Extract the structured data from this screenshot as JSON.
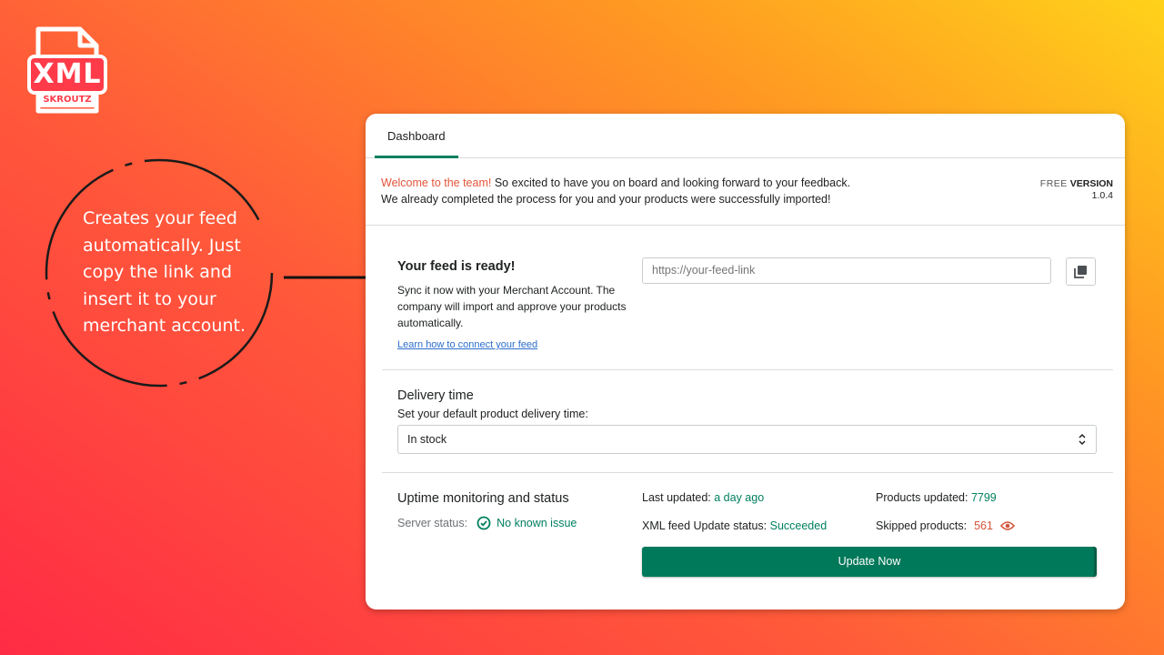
{
  "logo": {
    "text": "XML",
    "subtext": "SKROUTZ"
  },
  "callout": {
    "text": "Creates your feed automatically. Just copy the link and insert it to your merchant account."
  },
  "tabs": [
    {
      "label": "Dashboard"
    }
  ],
  "banner": {
    "welcome": "Welcome to the team!",
    "line1_rest": " So excited to have you on board and looking forward to your feedback.",
    "line2": "We already completed the process for you and your products were successfully imported!",
    "version_free": "FREE",
    "version_label": "VERSION",
    "version_number": "1.0.4"
  },
  "feed": {
    "title": "Your feed is ready!",
    "description": "Sync it now with your Merchant Account. The company will import and approve your products automatically.",
    "link_text": "Learn how to connect your feed",
    "input_placeholder": "https://your-feed-link",
    "copy_icon": "copy-icon"
  },
  "delivery": {
    "title": "Delivery time",
    "subtitle": "Set your default product delivery time:",
    "selected": "In stock"
  },
  "status": {
    "title": "Uptime monitoring and status",
    "server_label": "Server status:",
    "server_value": "No known issue",
    "last_updated_label": "Last updated:",
    "last_updated_value": "a day ago",
    "xml_status_label": "XML feed Update status:",
    "xml_status_value": "Succeeded",
    "products_updated_label": "Products updated:",
    "products_updated_value": "7799",
    "skipped_label": "Skipped products:",
    "skipped_value": "561",
    "update_button": "Update Now"
  },
  "colors": {
    "accent": "#008060",
    "button": "#00785a",
    "warning": "#d4533a",
    "link": "#2c6ecb"
  }
}
